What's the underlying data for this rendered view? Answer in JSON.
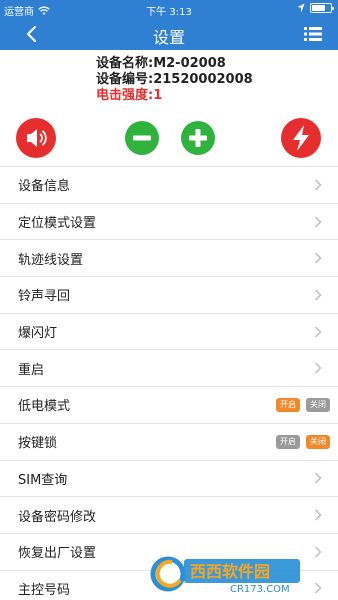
{
  "statusbar": {
    "carrier": "运营商",
    "time": "下午 3:13"
  },
  "navbar": {
    "title": "设置"
  },
  "device": {
    "name": "设备名称:M2-02008",
    "number": "设备编号:21520002008",
    "shock": "电击强度:1"
  },
  "colors": {
    "primary": "#2f7fd3",
    "danger": "#e62e2e",
    "green": "#2fb33d",
    "orange": "#f0892b"
  },
  "controls": {
    "sound_icon": "speaker-icon",
    "minus_icon": "minus-icon",
    "plus_icon": "plus-icon",
    "shock_icon": "lightning-icon"
  },
  "menu": [
    {
      "label": "设备信息"
    },
    {
      "label": "定位模式设置"
    },
    {
      "label": "轨迹线设置"
    },
    {
      "label": "铃声寻回"
    },
    {
      "label": "爆闪灯"
    },
    {
      "label": "重启"
    },
    {
      "label": "低电模式",
      "on": "开启",
      "off": "关闭"
    },
    {
      "label": "按键锁",
      "on": "开启",
      "off": "关闭"
    },
    {
      "label": "SIM查询"
    },
    {
      "label": "设备密码修改"
    },
    {
      "label": "恢复出厂设置"
    },
    {
      "label": "主控号码"
    }
  ],
  "watermark": {
    "brand": "西西软件园",
    "domain": "CR173.COM"
  }
}
